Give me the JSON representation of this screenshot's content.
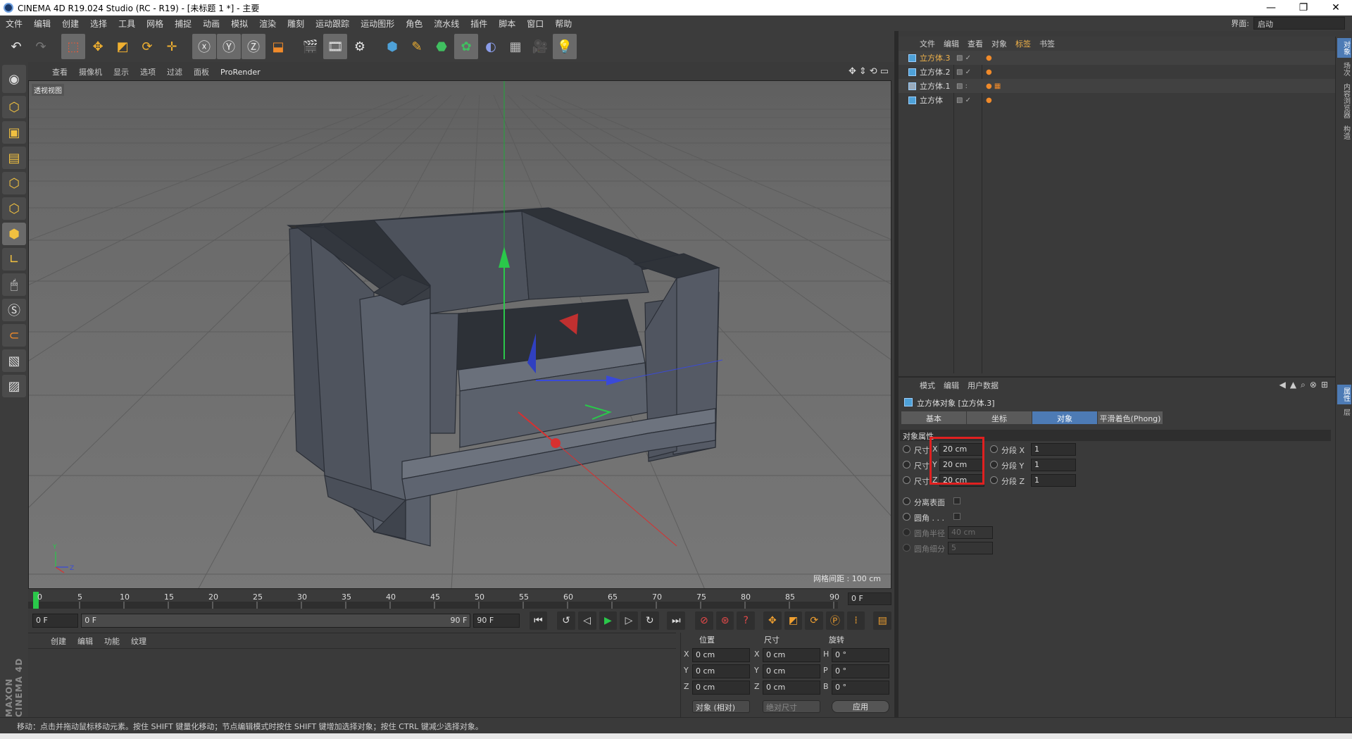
{
  "window": {
    "title": "CINEMA 4D R19.024 Studio (RC - R19) - [未标题 1 *] - 主要",
    "controls": [
      "—",
      "❐",
      "✕"
    ]
  },
  "menu": [
    "文件",
    "编辑",
    "创建",
    "选择",
    "工具",
    "网格",
    "捕捉",
    "动画",
    "模拟",
    "渲染",
    "雕刻",
    "运动跟踪",
    "运动图形",
    "角色",
    "流水线",
    "插件",
    "脚本",
    "窗口",
    "帮助"
  ],
  "layout": {
    "label": "界面:",
    "value": "启动"
  },
  "viewport": {
    "menu": [
      "查看",
      "摄像机",
      "显示",
      "选项",
      "过滤",
      "面板",
      "ProRender"
    ],
    "label": "透视视图",
    "grid_info": "网格间距 : 100 cm",
    "axis_y": "Y",
    "axis_z": "Z"
  },
  "timeline": {
    "ticks": [
      "0",
      "5",
      "10",
      "15",
      "20",
      "25",
      "30",
      "35",
      "40",
      "45",
      "50",
      "55",
      "60",
      "65",
      "70",
      "75",
      "80",
      "85",
      "90"
    ],
    "end_frame": "0 F"
  },
  "transport": {
    "start": "0 F",
    "range_start": "0 F",
    "range_end": "90 F",
    "end": "90 F"
  },
  "material": {
    "menu": [
      "创建",
      "编辑",
      "功能",
      "纹理"
    ]
  },
  "maxon": "MAXON CINEMA 4D",
  "coords": {
    "headers": {
      "position": "位置",
      "size": "尺寸",
      "rotation": "旋转"
    },
    "rows": [
      {
        "a": "X",
        "pos": "0 cm",
        "b": "X",
        "size": "0 cm",
        "c": "H",
        "rot": "0 °"
      },
      {
        "a": "Y",
        "pos": "0 cm",
        "b": "Y",
        "size": "0 cm",
        "c": "P",
        "rot": "0 °"
      },
      {
        "a": "Z",
        "pos": "0 cm",
        "b": "Z",
        "size": "0 cm",
        "c": "B",
        "rot": "0 °"
      }
    ],
    "mode": "对象 (相对)",
    "size_mode": "绝对尺寸",
    "apply": "应用"
  },
  "status": "移动：点击并拖动鼠标移动元素。按住 SHIFT 键量化移动；节点编辑模式时按住 SHIFT 键增加选择对象；按住 CTRL 键减少选择对象。",
  "object_manager": {
    "menu": [
      "文件",
      "编辑",
      "查看",
      "对象",
      "标签",
      "书签"
    ],
    "active_menu": "标签",
    "objects": [
      {
        "name": "立方体.3",
        "selected": true
      },
      {
        "name": "立方体.2",
        "selected": false
      },
      {
        "name": "立方体.1",
        "selected": false
      },
      {
        "name": "立方体",
        "selected": false
      }
    ]
  },
  "attributes": {
    "menu": [
      "模式",
      "编辑",
      "用户数据"
    ],
    "title": "立方体对象 [立方体.3]",
    "tabs": [
      "基本",
      "坐标",
      "对象",
      "平滑着色(Phong)"
    ],
    "active_tab": "对象",
    "section": "对象属性",
    "size_label": "尺寸",
    "size_axes": [
      "X",
      "Y",
      "Z"
    ],
    "size_values": [
      "20 cm",
      "20 cm",
      "20 cm"
    ],
    "seg_labels": [
      "分段 X",
      "分段 Y",
      "分段 Z"
    ],
    "seg_values": [
      "1",
      "1",
      "1"
    ],
    "separate_surfaces": "分离表面",
    "fillet": "圆角 . . .",
    "fillet_radius_label": "圆角半径",
    "fillet_radius": "40 cm",
    "fillet_sub_label": "圆角细分",
    "fillet_sub": "5"
  },
  "right_tabs": [
    "对象",
    "场次",
    "内容浏览器",
    "构造",
    "属性",
    "层"
  ]
}
